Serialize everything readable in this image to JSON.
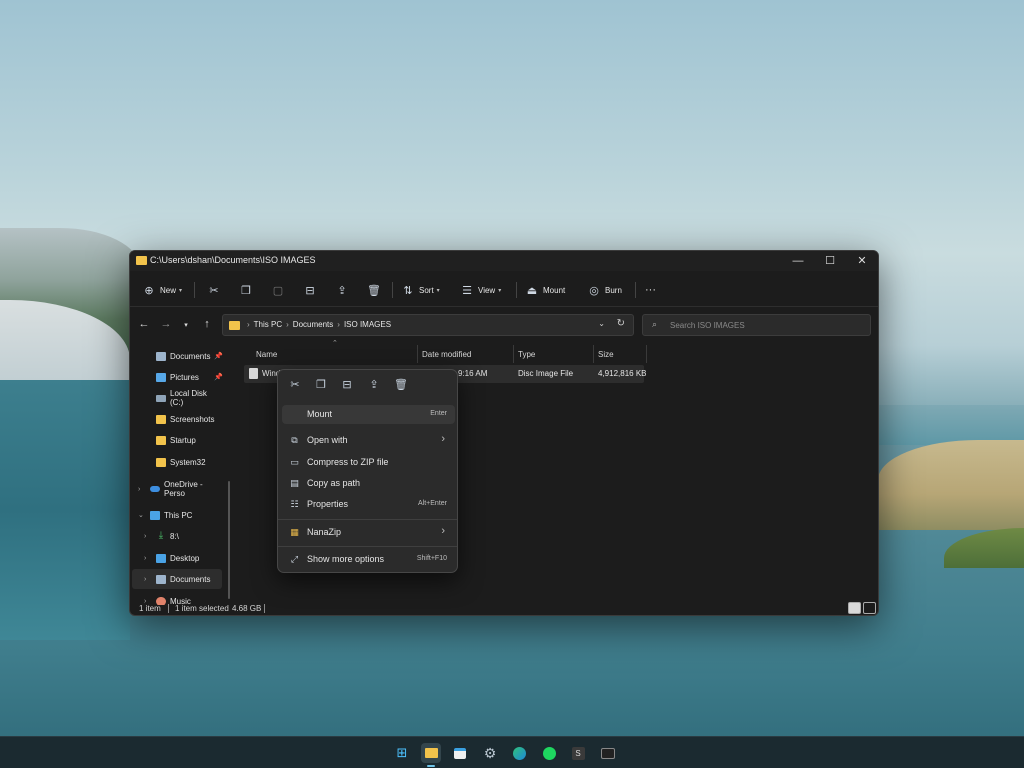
{
  "window": {
    "title": "C:\\Users\\dshan\\Documents\\ISO IMAGES",
    "minimize": "—",
    "maximize": "☐",
    "close": "✕"
  },
  "toolbar": {
    "new_label": "New",
    "sort_label": "Sort",
    "view_label": "View",
    "mount_label": "Mount",
    "burn_label": "Burn",
    "more_label": "···"
  },
  "address": {
    "crumbs": [
      "This PC",
      "Documents",
      "ISO IMAGES"
    ],
    "search_placeholder": "Search ISO IMAGES"
  },
  "sidebar": {
    "items": [
      {
        "label": "Documents",
        "icon": "documents-icon"
      },
      {
        "label": "Pictures",
        "icon": "pictures-icon"
      },
      {
        "label": "Local Disk (C:)",
        "icon": "disk-icon"
      },
      {
        "label": "Screenshots",
        "icon": "folder-icon"
      },
      {
        "label": "Startup",
        "icon": "folder-icon"
      },
      {
        "label": "System32",
        "icon": "folder-icon"
      },
      {
        "label": "OneDrive - Perso",
        "icon": "onedrive-icon"
      },
      {
        "label": "This PC",
        "icon": "this-pc-icon"
      },
      {
        "label": "8:\\",
        "icon": "download-icon"
      },
      {
        "label": "Desktop",
        "icon": "desktop-icon"
      },
      {
        "label": "Documents",
        "icon": "documents-icon"
      },
      {
        "label": "Music",
        "icon": "music-icon"
      }
    ]
  },
  "columns": {
    "name": "Name",
    "date": "Date modified",
    "type": "Type",
    "size": "Size"
  },
  "file": {
    "name": "Wind",
    "date": "9:16 AM",
    "type": "Disc Image File",
    "size": "4,912,816 KB"
  },
  "status": {
    "count": "1 item",
    "selected": "1 item selected",
    "size": "4.68 GB"
  },
  "context_menu": {
    "items": [
      {
        "label": "Mount",
        "shortcut": "Enter"
      },
      {
        "label": "Open with",
        "shortcut": ""
      },
      {
        "label": "Compress to ZIP file",
        "shortcut": ""
      },
      {
        "label": "Copy as path",
        "shortcut": ""
      },
      {
        "label": "Properties",
        "shortcut": "Alt+Enter"
      },
      {
        "label": "NanaZip",
        "shortcut": ""
      },
      {
        "label": "Show more options",
        "shortcut": "Shift+F10"
      }
    ]
  },
  "taskbar": {
    "icons": [
      "windows-start-icon",
      "file-explorer-icon",
      "microsoft-store-icon",
      "settings-icon",
      "edge-icon",
      "spotify-icon",
      "s-app-icon",
      "terminal-icon"
    ]
  }
}
